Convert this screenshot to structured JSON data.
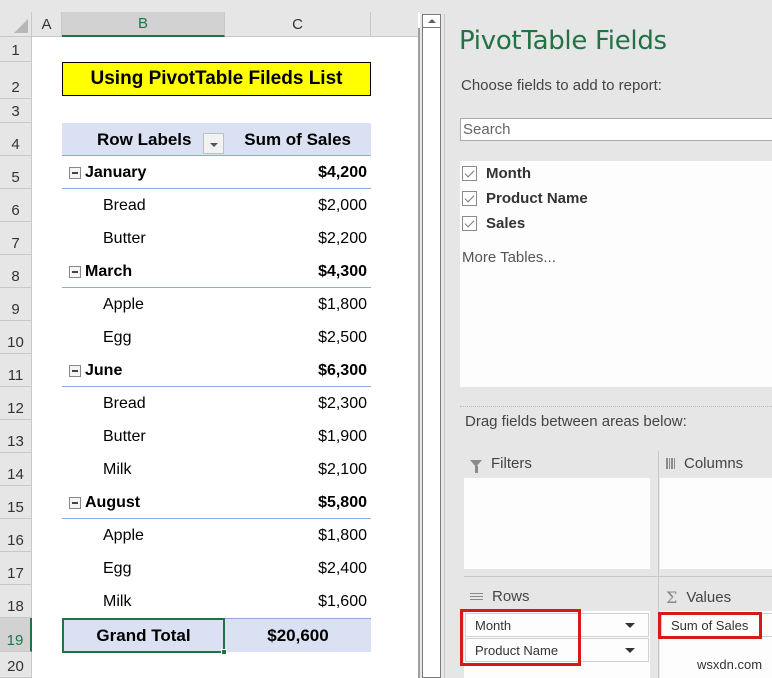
{
  "sheet": {
    "columns": [
      "A",
      "B",
      "C"
    ],
    "selected_column": "B",
    "rows": [
      "1",
      "2",
      "3",
      "4",
      "5",
      "6",
      "7",
      "8",
      "9",
      "10",
      "11",
      "12",
      "13",
      "14",
      "15",
      "16",
      "17",
      "18",
      "19",
      "20"
    ],
    "selected_row": "19",
    "title": "Using PivotTable Fileds List",
    "pivot": {
      "header_row_labels": "Row Labels",
      "header_values": "Sum of Sales",
      "groups": [
        {
          "month": "January",
          "total": "$4,200",
          "items": [
            {
              "product": "Bread",
              "sales": "$2,000"
            },
            {
              "product": "Butter",
              "sales": "$2,200"
            }
          ]
        },
        {
          "month": "March",
          "total": "$4,300",
          "items": [
            {
              "product": "Apple",
              "sales": "$1,800"
            },
            {
              "product": "Egg",
              "sales": "$2,500"
            }
          ]
        },
        {
          "month": "June",
          "total": "$6,300",
          "items": [
            {
              "product": "Bread",
              "sales": "$2,300"
            },
            {
              "product": "Butter",
              "sales": "$1,900"
            },
            {
              "product": "Milk",
              "sales": "$2,100"
            }
          ]
        },
        {
          "month": "August",
          "total": "$5,800",
          "items": [
            {
              "product": "Apple",
              "sales": "$1,800"
            },
            {
              "product": "Egg",
              "sales": "$2,400"
            },
            {
              "product": "Milk",
              "sales": "$1,600"
            }
          ]
        }
      ],
      "grand_total_label": "Grand Total",
      "grand_total_value": "$20,600"
    }
  },
  "pane": {
    "title": "PivotTable Fields",
    "subtitle": "Choose fields to add to report:",
    "search_placeholder": "Search",
    "fields": [
      {
        "label": "Month",
        "checked": true
      },
      {
        "label": "Product Name",
        "checked": true
      },
      {
        "label": "Sales",
        "checked": true
      }
    ],
    "more_tables": "More Tables...",
    "drag_label": "Drag fields between areas below:",
    "areas": {
      "filters": {
        "title": "Filters",
        "icon": "filter-icon",
        "items": []
      },
      "columns": {
        "title": "Columns",
        "icon": "columns-icon",
        "items": []
      },
      "rows": {
        "title": "Rows",
        "icon": "rows-icon",
        "items": [
          "Month",
          "Product Name"
        ]
      },
      "values": {
        "title": "Values",
        "icon": "sigma-icon",
        "items": [
          "Sum of Sales"
        ]
      }
    }
  },
  "colors": {
    "excel_green": "#217346",
    "title_fill": "#ffff00",
    "pivot_header_fill": "#d9e1f2",
    "highlight_red": "#d7191c"
  },
  "watermark": "wsxdn.com"
}
